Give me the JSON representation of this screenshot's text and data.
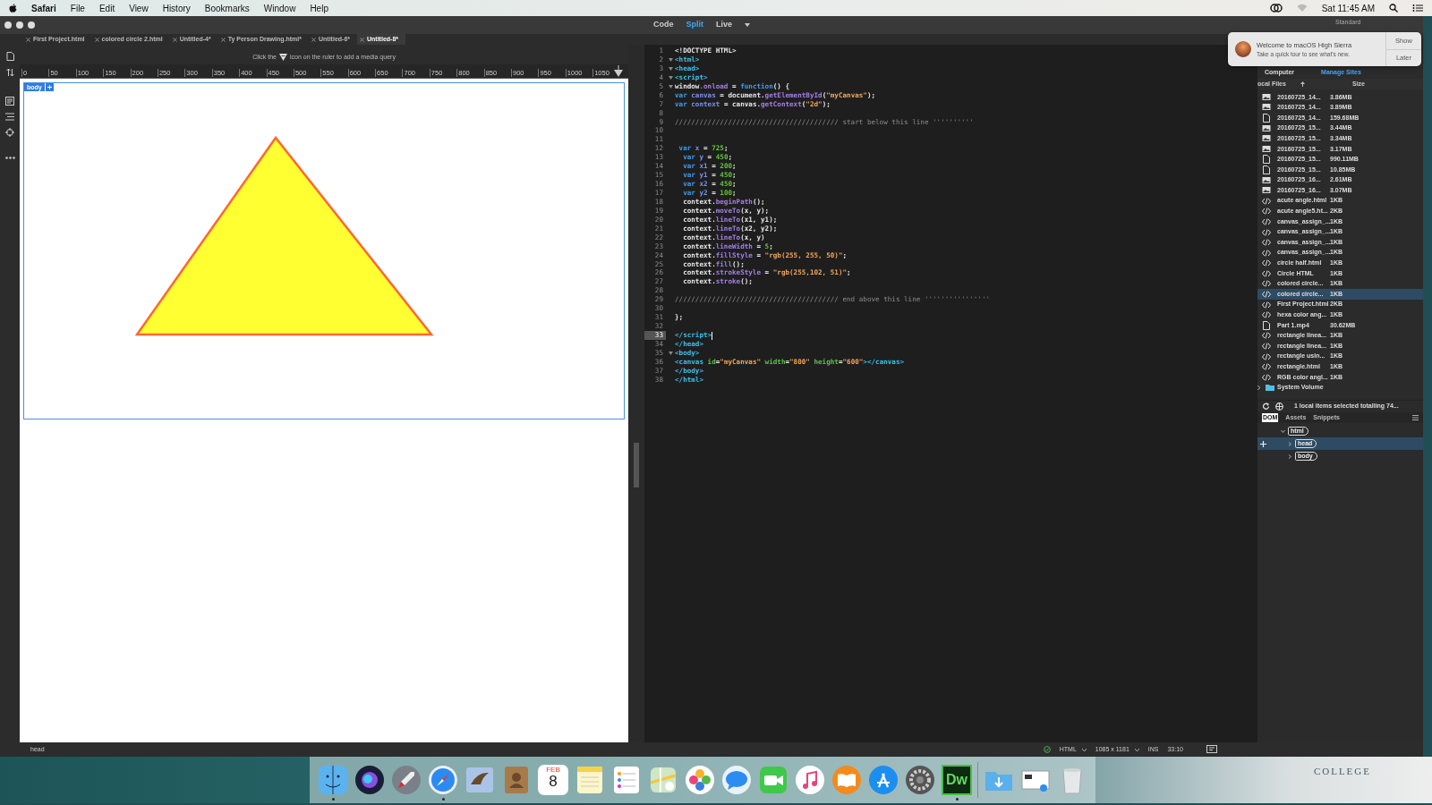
{
  "menu_bar": {
    "app": "Safari",
    "items": [
      "File",
      "Edit",
      "View",
      "History",
      "Bookmarks",
      "Window",
      "Help"
    ],
    "clock": "Sat 11:45 AM"
  },
  "window": {
    "views": [
      {
        "label": "Code",
        "selected": false
      },
      {
        "label": "Split",
        "selected": true
      },
      {
        "label": "Live",
        "selected": false,
        "dropdown": true
      }
    ],
    "workspace": "Standard"
  },
  "tabs": [
    {
      "label": "First Project.html",
      "selected": false
    },
    {
      "label": "colored circle 2.html",
      "selected": false
    },
    {
      "label": "Untitled-4*",
      "selected": false
    },
    {
      "label": "Ty Person Drawing.html*",
      "selected": false
    },
    {
      "label": "Untitled-6*",
      "selected": false
    },
    {
      "label": "Untitled-8*",
      "selected": true
    }
  ],
  "design_view": {
    "hint_before": "Click the",
    "hint_after": "icon on the ruler to add a media query",
    "ruler": [
      "0",
      "50",
      "100",
      "150",
      "200",
      "250",
      "300",
      "350",
      "400",
      "450",
      "500",
      "550",
      "600",
      "650",
      "700",
      "750",
      "800",
      "850",
      "900",
      "950",
      "1000",
      "1050"
    ],
    "element_tag": "body"
  },
  "code": {
    "lines": [
      {
        "number": "1",
        "foldable": false,
        "tokens": [
          {
            "kind": "plain",
            "text": "<!DOCTYPE HTML>"
          }
        ]
      },
      {
        "number": "2",
        "foldable": true,
        "tokens": [
          {
            "kind": "tag",
            "text": "<html>"
          }
        ]
      },
      {
        "number": "3",
        "foldable": true,
        "tokens": [
          {
            "kind": "tag",
            "text": "<head>"
          }
        ]
      },
      {
        "number": "4",
        "foldable": true,
        "tokens": [
          {
            "kind": "tag",
            "text": "<script>"
          }
        ]
      },
      {
        "number": "5",
        "foldable": true,
        "tokens": [
          {
            "kind": "plain",
            "text": "window"
          },
          {
            "kind": "prop",
            "text": ".onload"
          },
          {
            "kind": "plain",
            "text": " = "
          },
          {
            "kind": "keyword",
            "text": "function"
          },
          {
            "kind": "plain",
            "text": "() {"
          }
        ]
      },
      {
        "number": "6",
        "foldable": false,
        "tokens": [
          {
            "kind": "keyword",
            "text": "var "
          },
          {
            "kind": "variable",
            "text": "canvas"
          },
          {
            "kind": "plain",
            "text": " = document."
          },
          {
            "kind": "prop",
            "text": "getElementById"
          },
          {
            "kind": "plain",
            "text": "("
          },
          {
            "kind": "string",
            "text": "\"myCanvas\""
          },
          {
            "kind": "plain",
            "text": ");"
          }
        ]
      },
      {
        "number": "7",
        "foldable": false,
        "tokens": [
          {
            "kind": "keyword",
            "text": "var "
          },
          {
            "kind": "variable",
            "text": "context"
          },
          {
            "kind": "plain",
            "text": " = canvas."
          },
          {
            "kind": "prop",
            "text": "getContext"
          },
          {
            "kind": "plain",
            "text": "("
          },
          {
            "kind": "string",
            "text": "\"2d\""
          },
          {
            "kind": "plain",
            "text": ");"
          }
        ]
      },
      {
        "number": "8",
        "foldable": false
      },
      {
        "number": "9",
        "foldable": false,
        "tokens": [
          {
            "kind": "comment",
            "text": "//////////////////////////////////////// start below this line ''''''''''"
          }
        ]
      },
      {
        "number": "10",
        "foldable": false
      },
      {
        "number": "11",
        "foldable": false
      },
      {
        "number": "12",
        "foldable": false,
        "tokens": [
          {
            "kind": "keyword",
            "text": " var "
          },
          {
            "kind": "variable",
            "text": "x"
          },
          {
            "kind": "plain",
            "text": " = "
          },
          {
            "kind": "number",
            "text": "725"
          },
          {
            "kind": "plain",
            "text": ";"
          }
        ]
      },
      {
        "number": "13",
        "foldable": false,
        "tokens": [
          {
            "kind": "keyword",
            "text": "  var "
          },
          {
            "kind": "variable",
            "text": "y"
          },
          {
            "kind": "plain",
            "text": " = "
          },
          {
            "kind": "number",
            "text": "450"
          },
          {
            "kind": "plain",
            "text": ";"
          }
        ]
      },
      {
        "number": "14",
        "foldable": false,
        "tokens": [
          {
            "kind": "keyword",
            "text": "  var "
          },
          {
            "kind": "variable",
            "text": "x1"
          },
          {
            "kind": "plain",
            "text": " = "
          },
          {
            "kind": "number",
            "text": "200"
          },
          {
            "kind": "plain",
            "text": ";"
          }
        ]
      },
      {
        "number": "15",
        "foldable": false,
        "tokens": [
          {
            "kind": "keyword",
            "text": "  var "
          },
          {
            "kind": "variable",
            "text": "y1"
          },
          {
            "kind": "plain",
            "text": " = "
          },
          {
            "kind": "number",
            "text": "450"
          },
          {
            "kind": "plain",
            "text": ";"
          }
        ]
      },
      {
        "number": "16",
        "foldable": false,
        "tokens": [
          {
            "kind": "keyword",
            "text": "  var "
          },
          {
            "kind": "variable",
            "text": "x2"
          },
          {
            "kind": "plain",
            "text": " = "
          },
          {
            "kind": "number",
            "text": "450"
          },
          {
            "kind": "plain",
            "text": ";"
          }
        ]
      },
      {
        "number": "17",
        "foldable": false,
        "tokens": [
          {
            "kind": "keyword",
            "text": "  var "
          },
          {
            "kind": "variable",
            "text": "y2"
          },
          {
            "kind": "plain",
            "text": " = "
          },
          {
            "kind": "number",
            "text": "100"
          },
          {
            "kind": "plain",
            "text": ";"
          }
        ]
      },
      {
        "number": "18",
        "foldable": false,
        "tokens": [
          {
            "kind": "plain",
            "text": "  context."
          },
          {
            "kind": "prop",
            "text": "beginPath"
          },
          {
            "kind": "plain",
            "text": "();"
          }
        ]
      },
      {
        "number": "19",
        "foldable": false,
        "tokens": [
          {
            "kind": "plain",
            "text": "  context."
          },
          {
            "kind": "prop",
            "text": "moveTo"
          },
          {
            "kind": "plain",
            "text": "(x, y);"
          }
        ]
      },
      {
        "number": "20",
        "foldable": false,
        "tokens": [
          {
            "kind": "plain",
            "text": "  context."
          },
          {
            "kind": "prop",
            "text": "lineTo"
          },
          {
            "kind": "plain",
            "text": "(x1, y1);"
          }
        ]
      },
      {
        "number": "21",
        "foldable": false,
        "tokens": [
          {
            "kind": "plain",
            "text": "  context."
          },
          {
            "kind": "prop",
            "text": "lineTo"
          },
          {
            "kind": "plain",
            "text": "(x2, y2);"
          }
        ]
      },
      {
        "number": "22",
        "foldable": false,
        "tokens": [
          {
            "kind": "plain",
            "text": "  context."
          },
          {
            "kind": "prop",
            "text": "lineTo"
          },
          {
            "kind": "plain",
            "text": "(x, y)"
          }
        ]
      },
      {
        "number": "23",
        "foldable": false,
        "tokens": [
          {
            "kind": "plain",
            "text": "  context."
          },
          {
            "kind": "prop",
            "text": "lineWidth"
          },
          {
            "kind": "plain",
            "text": " = "
          },
          {
            "kind": "number",
            "text": "5"
          },
          {
            "kind": "plain",
            "text": ";"
          }
        ]
      },
      {
        "number": "24",
        "foldable": false,
        "tokens": [
          {
            "kind": "plain",
            "text": "  context."
          },
          {
            "kind": "prop",
            "text": "fillStyle"
          },
          {
            "kind": "plain",
            "text": " = "
          },
          {
            "kind": "string",
            "text": "\"rgb(255, 255, 50)\""
          },
          {
            "kind": "plain",
            "text": ";"
          }
        ]
      },
      {
        "number": "25",
        "foldable": false,
        "tokens": [
          {
            "kind": "plain",
            "text": "  context."
          },
          {
            "kind": "prop",
            "text": "fill"
          },
          {
            "kind": "plain",
            "text": "();"
          }
        ]
      },
      {
        "number": "26",
        "foldable": false,
        "tokens": [
          {
            "kind": "plain",
            "text": "  context."
          },
          {
            "kind": "prop",
            "text": "strokeStyle"
          },
          {
            "kind": "plain",
            "text": " = "
          },
          {
            "kind": "string",
            "text": "\"rgb(255,102, 51)\""
          },
          {
            "kind": "plain",
            "text": ";"
          }
        ]
      },
      {
        "number": "27",
        "foldable": false,
        "tokens": [
          {
            "kind": "plain",
            "text": "  context."
          },
          {
            "kind": "prop",
            "text": "stroke"
          },
          {
            "kind": "plain",
            "text": "();"
          }
        ]
      },
      {
        "number": "28",
        "foldable": false
      },
      {
        "number": "29",
        "foldable": false,
        "tokens": [
          {
            "kind": "comment",
            "text": "//////////////////////////////////////// end above this line ''''''''''''''''"
          }
        ]
      },
      {
        "number": "30",
        "foldable": false
      },
      {
        "number": "31",
        "foldable": false,
        "tokens": [
          {
            "kind": "plain",
            "text": "};"
          }
        ]
      },
      {
        "number": "32",
        "foldable": false
      },
      {
        "number": "33",
        "foldable": false,
        "current": true,
        "tokens": [
          {
            "kind": "tag",
            "text": "</script>"
          }
        ]
      },
      {
        "number": "34",
        "foldable": false,
        "tokens": [
          {
            "kind": "tag",
            "text": "</head>"
          }
        ]
      },
      {
        "number": "35",
        "foldable": true,
        "tokens": [
          {
            "kind": "tag",
            "text": "<body>"
          }
        ]
      },
      {
        "number": "36",
        "foldable": false,
        "tokens": [
          {
            "kind": "tag",
            "text": "<canvas "
          },
          {
            "kind": "attr",
            "text": "id"
          },
          {
            "kind": "plain",
            "text": "="
          },
          {
            "kind": "string",
            "text": "\"myCanvas\""
          },
          {
            "kind": "attr",
            "text": " width"
          },
          {
            "kind": "plain",
            "text": "="
          },
          {
            "kind": "string",
            "text": "\"800\""
          },
          {
            "kind": "attr",
            "text": " height"
          },
          {
            "kind": "plain",
            "text": "="
          },
          {
            "kind": "string",
            "text": "\"600\""
          },
          {
            "kind": "tag",
            "text": "></canvas>"
          }
        ]
      },
      {
        "number": "37",
        "foldable": false,
        "tokens": [
          {
            "kind": "tag",
            "text": "</body>"
          }
        ]
      },
      {
        "number": "38",
        "foldable": false,
        "tokens": [
          {
            "kind": "tag",
            "text": "</html>"
          }
        ]
      }
    ]
  },
  "notification": {
    "title": "Welcome to macOS High Sierra",
    "body": "Take a quick tour to see what's new.",
    "buttons": [
      "Show",
      "Later"
    ]
  },
  "files_panel": {
    "site": "Computer",
    "manage_link": "Manage Sites",
    "columns": [
      "ocal Files",
      "Size"
    ],
    "files": [
      {
        "name": "20160725_14...",
        "size": "3.86MB",
        "kind": "image",
        "selected": false
      },
      {
        "name": "20160725_14...",
        "size": "3.89MB",
        "kind": "image",
        "selected": false
      },
      {
        "name": "20160725_14...",
        "size": "159.68MB",
        "kind": "file",
        "selected": false
      },
      {
        "name": "20160725_15...",
        "size": "3.44MB",
        "kind": "image",
        "selected": false
      },
      {
        "name": "20160725_15...",
        "size": "3.34MB",
        "kind": "image",
        "selected": false
      },
      {
        "name": "20160725_15...",
        "size": "3.17MB",
        "kind": "image",
        "selected": false
      },
      {
        "name": "20160725_15...",
        "size": "990.11MB",
        "kind": "file",
        "selected": false
      },
      {
        "name": "20160725_15...",
        "size": "10.85MB",
        "kind": "file",
        "selected": false
      },
      {
        "name": "20160725_16...",
        "size": "2.61MB",
        "kind": "image",
        "selected": false
      },
      {
        "name": "20160725_16...",
        "size": "3.07MB",
        "kind": "image",
        "selected": false
      },
      {
        "name": "acute angle.html",
        "size": "1KB",
        "kind": "code",
        "selected": false
      },
      {
        "name": "acute angle5.ht...",
        "size": "2KB",
        "kind": "code",
        "selected": false
      },
      {
        "name": "canvas_assign_...",
        "size": "1KB",
        "kind": "code",
        "selected": false
      },
      {
        "name": "canvas_assign_...",
        "size": "1KB",
        "kind": "code",
        "selected": false
      },
      {
        "name": "canvas_assign_...",
        "size": "1KB",
        "kind": "code",
        "selected": false
      },
      {
        "name": "canvas_assign_...",
        "size": "1KB",
        "kind": "code",
        "selected": false
      },
      {
        "name": "circle half.html",
        "size": "1KB",
        "kind": "code",
        "selected": false
      },
      {
        "name": "Circle HTML",
        "size": "1KB",
        "kind": "code",
        "selected": false
      },
      {
        "name": "colored circle...",
        "size": "1KB",
        "kind": "code",
        "selected": false
      },
      {
        "name": "colored circle...",
        "size": "1KB",
        "kind": "code",
        "selected": true
      },
      {
        "name": "First Project.html",
        "size": "2KB",
        "kind": "code",
        "selected": false
      },
      {
        "name": "hexa color ang...",
        "size": "1KB",
        "kind": "code",
        "selected": false
      },
      {
        "name": "Part 1.mp4",
        "size": "30.62MB",
        "kind": "file",
        "selected": false
      },
      {
        "name": "rectangle linea...",
        "size": "1KB",
        "kind": "code",
        "selected": false
      },
      {
        "name": "rectangle linea...",
        "size": "1KB",
        "kind": "code",
        "selected": false
      },
      {
        "name": "rectangle usin...",
        "size": "1KB",
        "kind": "code",
        "selected": false
      },
      {
        "name": "rectangle.html",
        "size": "1KB",
        "kind": "code",
        "selected": false
      },
      {
        "name": "RGB color angl...",
        "size": "1KB",
        "kind": "code",
        "selected": false
      },
      {
        "name": "System Volume",
        "kind": "folder",
        "selected": false
      }
    ],
    "status": "1 local items selected totalling 74..."
  },
  "dom_panel": {
    "tabs": [
      {
        "label": "DOM",
        "selected": true
      },
      {
        "label": "Assets",
        "selected": false
      },
      {
        "label": "Snippets",
        "selected": false
      }
    ],
    "tree": [
      {
        "tag": "html",
        "expanded": true,
        "selected": false,
        "children": [
          {
            "tag": "head",
            "expanded": false,
            "selected": true
          },
          {
            "tag": "body",
            "expanded": false,
            "selected": false
          }
        ]
      }
    ]
  },
  "status_bar": {
    "tag_path": "head",
    "language": "HTML",
    "size": "1085 x 1181",
    "mode": "INS",
    "position": "33:10"
  },
  "dock": [
    {
      "kind": "finder",
      "running": true
    },
    {
      "kind": "siri",
      "running": false
    },
    {
      "kind": "rocket",
      "running": false
    },
    {
      "kind": "compass",
      "running": true
    },
    {
      "kind": "bird",
      "running": false
    },
    {
      "kind": "addressbook",
      "running": false
    },
    {
      "kind": "calendar",
      "running": false,
      "month": "FEB",
      "day": "8"
    },
    {
      "kind": "notepad",
      "running": false
    },
    {
      "kind": "checklist",
      "running": false
    },
    {
      "kind": "map",
      "running": false
    },
    {
      "kind": "flower",
      "running": false
    },
    {
      "kind": "bubble",
      "running": false
    },
    {
      "kind": "camera",
      "running": false
    },
    {
      "kind": "music",
      "running": false
    },
    {
      "kind": "book",
      "running": false
    },
    {
      "kind": "appstore",
      "running": false
    },
    {
      "kind": "gear",
      "running": false
    },
    {
      "kind": "texttile",
      "running": true,
      "text": "Dw"
    },
    {
      "kind": "separator"
    },
    {
      "kind": "folder",
      "running": false
    },
    {
      "kind": "window",
      "running": false
    },
    {
      "kind": "trash",
      "running": false
    }
  ],
  "desktop": {
    "wallpaper_text": "COLLEGE"
  }
}
